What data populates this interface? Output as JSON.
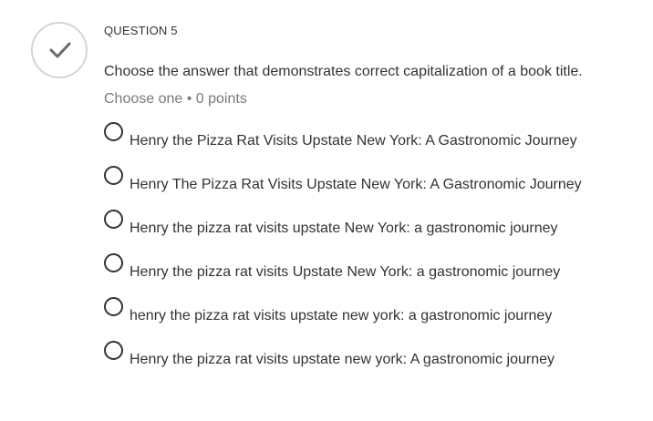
{
  "question": {
    "status_icon": "checkmark-icon",
    "number_label": "QUESTION 5",
    "prompt": "Choose the answer that demonstrates correct capitalization of a book title.",
    "meta": "Choose one • 0 points",
    "options": [
      {
        "label": "Henry the Pizza Rat Visits Upstate New York: A Gastronomic Journey"
      },
      {
        "label": "Henry The Pizza Rat Visits Upstate New York: A Gastronomic Journey"
      },
      {
        "label": "Henry the pizza rat visits upstate New York: a gastronomic journey"
      },
      {
        "label": "Henry the pizza rat visits Upstate New York: a gastronomic journey"
      },
      {
        "label": "henry the pizza rat visits upstate new york: a gastronomic journey"
      },
      {
        "label": "Henry the pizza rat visits upstate new york: A gastronomic journey"
      }
    ]
  },
  "colors": {
    "text": "#333333",
    "muted": "#7a7a7a",
    "circle_border": "#d5d5d5",
    "check": "#6b6b6b"
  }
}
